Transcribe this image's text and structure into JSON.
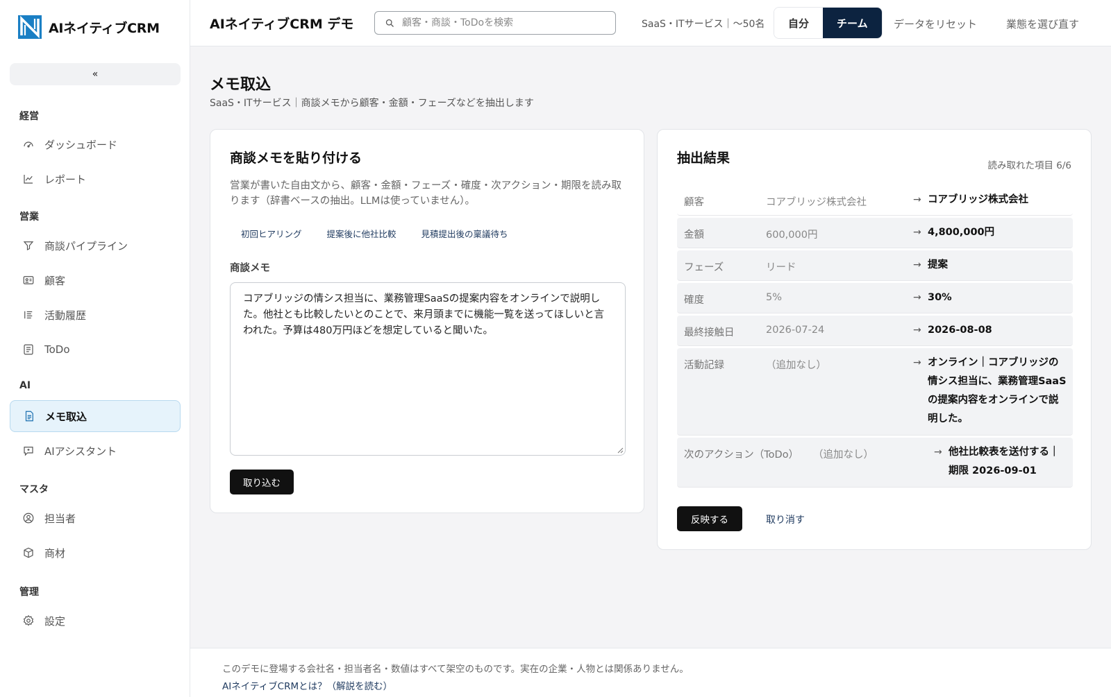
{
  "brand": {
    "name": "AIネイティブCRM",
    "accent": "#0c2340",
    "highlight": "#e6f3fb"
  },
  "sidebar": {
    "collapse_label": "«",
    "sections": [
      {
        "title": "経営",
        "items": [
          {
            "label": "ダッシュボード",
            "icon": "gauge-icon"
          },
          {
            "label": "レポート",
            "icon": "chart-line-icon"
          }
        ]
      },
      {
        "title": "営業",
        "items": [
          {
            "label": "商談パイプライン",
            "icon": "funnel-icon"
          },
          {
            "label": "顧客",
            "icon": "id-card-icon"
          },
          {
            "label": "活動履歴",
            "icon": "list-icon"
          },
          {
            "label": "ToDo",
            "icon": "checklist-icon"
          }
        ]
      },
      {
        "title": "AI",
        "items": [
          {
            "label": "メモ取込",
            "icon": "document-icon",
            "active": true
          },
          {
            "label": "AIアシスタント",
            "icon": "chat-icon"
          }
        ]
      },
      {
        "title": "マスタ",
        "items": [
          {
            "label": "担当者",
            "icon": "user-circle-icon"
          },
          {
            "label": "商材",
            "icon": "box-icon"
          }
        ]
      },
      {
        "title": "管理",
        "items": [
          {
            "label": "設定",
            "icon": "gear-icon"
          }
        ]
      }
    ]
  },
  "header": {
    "title": "AIネイティブCRM デモ",
    "search_placeholder": "顧客・商談・ToDoを検索",
    "industry": "SaaS・ITサービス｜〜50名",
    "scope_self": "自分",
    "scope_team": "チーム",
    "reset": "データをリセット",
    "reselect": "業態を選び直す"
  },
  "page": {
    "title": "メモ取込",
    "subtitle": "SaaS・ITサービス｜商談メモから顧客・金額・フェーズなどを抽出します"
  },
  "input_card": {
    "title": "商談メモを貼り付ける",
    "description": "営業が書いた自由文から、顧客・金額・フェーズ・確度・次アクション・期限を読み取ります（辞書ベースの抽出。LLMは使っていません）。",
    "samples": [
      "初回ヒアリング",
      "提案後に他社比較",
      "見積提出後の稟議待ち"
    ],
    "memo_label": "商談メモ",
    "memo_value": "コアブリッジの情シス担当に、業務管理SaaSの提案内容をオンラインで説明した。他社とも比較したいとのことで、来月頭までに機能一覧を送ってほしいと言われた。予算は480万円ほどを想定していると聞いた。",
    "submit": "取り込む"
  },
  "result_card": {
    "title": "抽出結果",
    "read_count": "読み取れた項目 6/6",
    "arrow": "→",
    "rows": [
      {
        "label": "顧客",
        "old": "コアブリッジ株式会社",
        "new": "コアブリッジ株式会社"
      },
      {
        "label": "金額",
        "old": "600,000円",
        "new": "4,800,000円"
      },
      {
        "label": "フェーズ",
        "old": "リード",
        "new": "提案"
      },
      {
        "label": "確度",
        "old": "5%",
        "new": "30%"
      },
      {
        "label": "最終接触日",
        "old": "2026-07-24",
        "new": "2026-08-08"
      },
      {
        "label": "活動記録",
        "old": "（追加なし）",
        "new_lines": [
          "オンライン｜コアブリッジの",
          "情シス担当に、業務管理SaaS",
          "の提案内容をオンラインで説",
          "明した。"
        ]
      },
      {
        "label": "次のアクション（ToDo）",
        "old": "（追加なし）",
        "new_lines": [
          "他社比較表を送付する｜",
          "期限 2026-09-01"
        ]
      }
    ],
    "apply": "反映する",
    "cancel": "取り消す"
  },
  "footer": {
    "note": "このデモに登場する会社名・担当者名・数値はすべて架空のものです。実在の企業・人物とは関係ありません。",
    "about": "AIネイティブCRMとは？（解説を読む）"
  }
}
